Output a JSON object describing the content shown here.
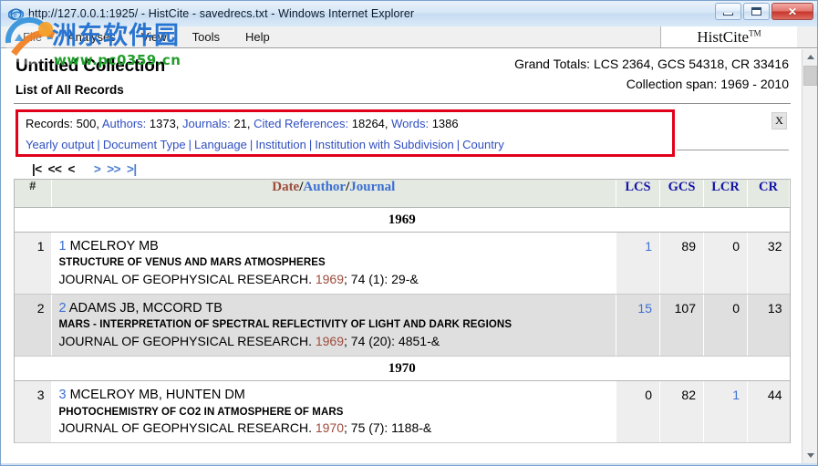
{
  "window": {
    "title": "http://127.0.0.1:1925/ - HistCite - savedrecs.txt - Windows Internet Explorer",
    "minimize_label": "Minimize",
    "maximize_label": "Maximize",
    "close_label": "✕"
  },
  "menu": {
    "items": [
      "File",
      "Analyses",
      "View",
      "Tools",
      "Help"
    ],
    "brand": "HistCite",
    "brand_tm": "TM"
  },
  "header": {
    "collection_title": "Untitled Collection",
    "collection_subtitle": "List of All Records",
    "grand_totals": "Grand Totals: LCS 2364, GCS 54318, CR 33416",
    "collection_span": "Collection span: 1969 - 2010"
  },
  "stats": {
    "records_label": "Records:",
    "records_value": " 500, ",
    "authors_label": "Authors:",
    "authors_value": " 1373, ",
    "journals_label": "Journals:",
    "journals_value": " 21, ",
    "cited_refs_label": "Cited References:",
    "cited_refs_value": " 18264, ",
    "words_label": "Words:",
    "words_value": " 1386",
    "links": [
      "Yearly output",
      "Document Type",
      "Language",
      "Institution",
      "Institution with Subdivision",
      "Country"
    ],
    "separator": "|",
    "close_label": "X"
  },
  "pager": {
    "first": "|<",
    "prev_block": "<<",
    "prev": "<",
    "next": ">",
    "next_block": ">>",
    "last": ">|"
  },
  "table": {
    "headers": {
      "num": "#",
      "date": "Date",
      "slash": "/",
      "author": "Author",
      "journal": "Journal",
      "lcs": "LCS",
      "gcs": "GCS",
      "lcr": "LCR",
      "cr": "CR"
    },
    "groups": [
      {
        "year": "1969",
        "records": [
          {
            "num": "1",
            "id": "1",
            "authors": "MCELROY MB",
            "title": "STRUCTURE OF VENUS AND MARS ATMOSPHERES",
            "journal": "JOURNAL OF GEOPHYSICAL RESEARCH.",
            "year": "1969",
            "citation": "; 74 (1): 29-&",
            "lcs": "1",
            "lcs_link": true,
            "gcs": "89",
            "gcs_link": false,
            "lcr": "0",
            "lcr_link": false,
            "cr": "32",
            "cr_link": false
          },
          {
            "num": "2",
            "id": "2",
            "authors": "ADAMS JB, MCCORD TB",
            "title": "MARS - INTERPRETATION OF SPECTRAL REFLECTIVITY OF LIGHT AND DARK REGIONS",
            "journal": "JOURNAL OF GEOPHYSICAL RESEARCH.",
            "year": "1969",
            "citation": "; 74 (20): 4851-&",
            "lcs": "15",
            "lcs_link": true,
            "gcs": "107",
            "gcs_link": false,
            "lcr": "0",
            "lcr_link": false,
            "cr": "13",
            "cr_link": false
          }
        ]
      },
      {
        "year": "1970",
        "records": [
          {
            "num": "3",
            "id": "3",
            "authors": "MCELROY MB, HUNTEN DM",
            "title": "PHOTOCHEMISTRY OF CO2 IN ATMOSPHERE OF MARS",
            "journal": "JOURNAL OF GEOPHYSICAL RESEARCH.",
            "year": "1970",
            "citation": "; 75 (7): 1188-&",
            "lcs": "0",
            "lcs_link": false,
            "gcs": "82",
            "gcs_link": false,
            "lcr": "1",
            "lcr_link": true,
            "cr": "44",
            "cr_link": false
          }
        ]
      }
    ]
  },
  "watermark": {
    "cn_text": "洲东软件园",
    "url_text": "www.pc0359.cn"
  },
  "colors": {
    "link_blue": "#2f4fc0",
    "accent_red": "#e2001a",
    "year_red": "#9e4b3c",
    "metric_blue": "#1414a8"
  }
}
